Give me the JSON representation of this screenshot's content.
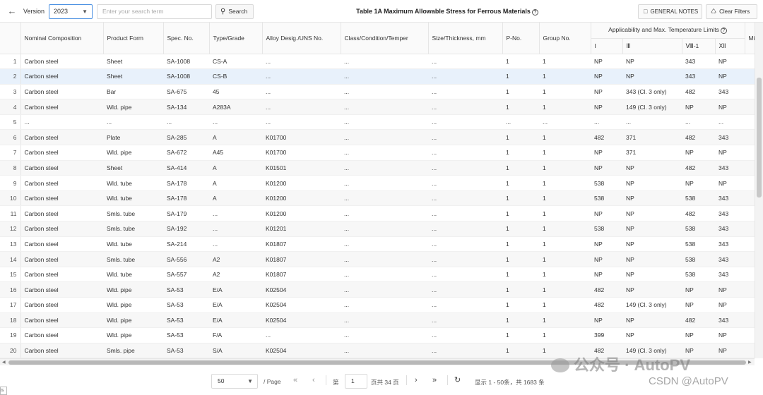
{
  "toolbar": {
    "back_icon": "arrow-left-icon",
    "version_label": "Version",
    "version_value": "2023",
    "search_placeholder": "Enter your search term",
    "search_button": "Search",
    "title": "Table 1A Maximum Allowable Stress for Ferrous Materials",
    "general_notes": "GENERAL NOTES",
    "clear_filters": "Clear Filters"
  },
  "columns": {
    "composition": "Nominal Composition",
    "form": "Product Form",
    "spec": "Spec. No.",
    "grade": "Type/Grade",
    "alloy": "Alloy Desig./UNS No.",
    "class": "Class/Condition/Temper",
    "size": "Size/Thickness, mm",
    "pno": "P-No.",
    "group": "Group No.",
    "applicability": "Applicability and Max. Temperature Limits",
    "sub_i": "I",
    "sub_iii": "Ⅲ",
    "sub_viii": "Ⅷ-1",
    "sub_xii": "ⅩⅡ",
    "min": "Mi"
  },
  "rows": [
    {
      "n": "1",
      "comp": "Carbon steel",
      "form": "Sheet",
      "spec": "SA-1008",
      "grade": "CS-A",
      "alloy": "...",
      "cls": "...",
      "size": "...",
      "pno": "1",
      "grp": "1",
      "i": "NP",
      "iii": "NP",
      "viii": "343",
      "xii": "NP"
    },
    {
      "n": "2",
      "comp": "Carbon steel",
      "form": "Sheet",
      "spec": "SA-1008",
      "grade": "CS-B",
      "alloy": "...",
      "cls": "...",
      "size": "...",
      "pno": "1",
      "grp": "1",
      "i": "NP",
      "iii": "NP",
      "viii": "343",
      "xii": "NP"
    },
    {
      "n": "3",
      "comp": "Carbon steel",
      "form": "Bar",
      "spec": "SA-675",
      "grade": "45",
      "alloy": "...",
      "cls": "...",
      "size": "...",
      "pno": "1",
      "grp": "1",
      "i": "NP",
      "iii": "343 (Cl. 3 only)",
      "viii": "482",
      "xii": "343"
    },
    {
      "n": "4",
      "comp": "Carbon steel",
      "form": "Wld. pipe",
      "spec": "SA-134",
      "grade": "A283A",
      "alloy": "...",
      "cls": "...",
      "size": "...",
      "pno": "1",
      "grp": "1",
      "i": "NP",
      "iii": "149 (Cl. 3 only)",
      "viii": "NP",
      "xii": "NP"
    },
    {
      "n": "5",
      "comp": "...",
      "form": "...",
      "spec": "...",
      "grade": "...",
      "alloy": "...",
      "cls": "...",
      "size": "...",
      "pno": "...",
      "grp": "...",
      "i": "...",
      "iii": "...",
      "viii": "...",
      "xii": "..."
    },
    {
      "n": "6",
      "comp": "Carbon steel",
      "form": "Plate",
      "spec": "SA-285",
      "grade": "A",
      "alloy": "K01700",
      "cls": "...",
      "size": "...",
      "pno": "1",
      "grp": "1",
      "i": "482",
      "iii": "371",
      "viii": "482",
      "xii": "343"
    },
    {
      "n": "7",
      "comp": "Carbon steel",
      "form": "Wld. pipe",
      "spec": "SA-672",
      "grade": "A45",
      "alloy": "K01700",
      "cls": "...",
      "size": "...",
      "pno": "1",
      "grp": "1",
      "i": "NP",
      "iii": "371",
      "viii": "NP",
      "xii": "NP"
    },
    {
      "n": "8",
      "comp": "Carbon steel",
      "form": "Sheet",
      "spec": "SA-414",
      "grade": "A",
      "alloy": "K01501",
      "cls": "...",
      "size": "...",
      "pno": "1",
      "grp": "1",
      "i": "NP",
      "iii": "NP",
      "viii": "482",
      "xii": "343"
    },
    {
      "n": "9",
      "comp": "Carbon steel",
      "form": "Wld. tube",
      "spec": "SA-178",
      "grade": "A",
      "alloy": "K01200",
      "cls": "...",
      "size": "...",
      "pno": "1",
      "grp": "1",
      "i": "538",
      "iii": "NP",
      "viii": "NP",
      "xii": "NP"
    },
    {
      "n": "10",
      "comp": "Carbon steel",
      "form": "Wld. tube",
      "spec": "SA-178",
      "grade": "A",
      "alloy": "K01200",
      "cls": "...",
      "size": "...",
      "pno": "1",
      "grp": "1",
      "i": "538",
      "iii": "NP",
      "viii": "538",
      "xii": "343"
    },
    {
      "n": "11",
      "comp": "Carbon steel",
      "form": "Smls. tube",
      "spec": "SA-179",
      "grade": "...",
      "alloy": "K01200",
      "cls": "...",
      "size": "...",
      "pno": "1",
      "grp": "1",
      "i": "NP",
      "iii": "NP",
      "viii": "482",
      "xii": "343"
    },
    {
      "n": "12",
      "comp": "Carbon steel",
      "form": "Smls. tube",
      "spec": "SA-192",
      "grade": "...",
      "alloy": "K01201",
      "cls": "...",
      "size": "...",
      "pno": "1",
      "grp": "1",
      "i": "538",
      "iii": "NP",
      "viii": "538",
      "xii": "343"
    },
    {
      "n": "13",
      "comp": "Carbon steel",
      "form": "Wld. tube",
      "spec": "SA-214",
      "grade": "...",
      "alloy": "K01807",
      "cls": "...",
      "size": "...",
      "pno": "1",
      "grp": "1",
      "i": "NP",
      "iii": "NP",
      "viii": "538",
      "xii": "343"
    },
    {
      "n": "14",
      "comp": "Carbon steel",
      "form": "Smls. tube",
      "spec": "SA-556",
      "grade": "A2",
      "alloy": "K01807",
      "cls": "...",
      "size": "...",
      "pno": "1",
      "grp": "1",
      "i": "NP",
      "iii": "NP",
      "viii": "538",
      "xii": "343"
    },
    {
      "n": "15",
      "comp": "Carbon steel",
      "form": "Wld. tube",
      "spec": "SA-557",
      "grade": "A2",
      "alloy": "K01807",
      "cls": "...",
      "size": "...",
      "pno": "1",
      "grp": "1",
      "i": "NP",
      "iii": "NP",
      "viii": "538",
      "xii": "343"
    },
    {
      "n": "16",
      "comp": "Carbon steel",
      "form": "Wld. pipe",
      "spec": "SA-53",
      "grade": "E/A",
      "alloy": "K02504",
      "cls": "...",
      "size": "...",
      "pno": "1",
      "grp": "1",
      "i": "482",
      "iii": "NP",
      "viii": "NP",
      "xii": "NP"
    },
    {
      "n": "17",
      "comp": "Carbon steel",
      "form": "Wld. pipe",
      "spec": "SA-53",
      "grade": "E/A",
      "alloy": "K02504",
      "cls": "...",
      "size": "...",
      "pno": "1",
      "grp": "1",
      "i": "482",
      "iii": "149 (Cl. 3 only)",
      "viii": "NP",
      "xii": "NP"
    },
    {
      "n": "18",
      "comp": "Carbon steel",
      "form": "Wld. pipe",
      "spec": "SA-53",
      "grade": "E/A",
      "alloy": "K02504",
      "cls": "...",
      "size": "...",
      "pno": "1",
      "grp": "1",
      "i": "NP",
      "iii": "NP",
      "viii": "482",
      "xii": "343"
    },
    {
      "n": "19",
      "comp": "Carbon steel",
      "form": "Wld. pipe",
      "spec": "SA-53",
      "grade": "F/A",
      "alloy": "...",
      "cls": "...",
      "size": "...",
      "pno": "1",
      "grp": "1",
      "i": "399",
      "iii": "NP",
      "viii": "NP",
      "xii": "NP"
    },
    {
      "n": "20",
      "comp": "Carbon steel",
      "form": "Smls. pipe",
      "spec": "SA-53",
      "grade": "S/A",
      "alloy": "K02504",
      "cls": "...",
      "size": "...",
      "pno": "1",
      "grp": "1",
      "i": "482",
      "iii": "149 (Cl. 3 only)",
      "viii": "NP",
      "xii": "NP"
    }
  ],
  "selected_row": "2",
  "pager": {
    "page_size": "50",
    "per_page_label": "/ Page",
    "page_prefix": "第",
    "page_value": "1",
    "page_suffix": "页共 34 页",
    "summary": "显示 1 - 50条，共 1683 条"
  },
  "watermark": {
    "text": "公众号 · AutoPV",
    "credit": "CSDN @AutoPV"
  },
  "colors": {
    "accent": "#4a90e2",
    "selected_row": "#e8f1fb",
    "stripe": "#f7f7f7"
  }
}
